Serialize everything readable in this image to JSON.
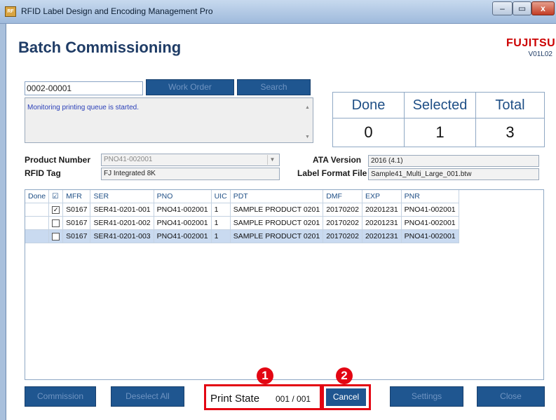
{
  "window": {
    "title": "RFID Label Design and Encoding Management Pro",
    "app_icon": "rfid-app-icon",
    "min_glyph": "–",
    "max_glyph": "▭",
    "close_glyph": "x"
  },
  "header": {
    "title": "Batch Commissioning",
    "logo": "FUJITSU",
    "version": "V01L02"
  },
  "order": {
    "value": "0002-00001",
    "work_order_label": "Work Order",
    "search_label": "Search"
  },
  "message": {
    "text": "Monitoring printing queue is started."
  },
  "counters": {
    "done_label": "Done",
    "done_value": "0",
    "selected_label": "Selected",
    "selected_value": "1",
    "total_label": "Total",
    "total_value": "3"
  },
  "product": {
    "product_number_label": "Product Number",
    "product_number_value": "PNO41-002001",
    "rfid_tag_label": "RFID Tag",
    "rfid_tag_value": "FJ Integrated 8K",
    "ata_version_label": "ATA Version",
    "ata_version_value": "2016 (4.1)",
    "label_format_label": "Label Format File",
    "label_format_value": "Sample41_Multi_Large_001.btw"
  },
  "table": {
    "headers": [
      "Done",
      "☑",
      "MFR",
      "SER",
      "PNO",
      "UIC",
      "PDT",
      "DMF",
      "EXP",
      "PNR"
    ],
    "rows": [
      {
        "done": "",
        "check": "✓",
        "mfr": "S0167",
        "ser": "SER41-0201-001",
        "pno": "PNO41-002001",
        "uic": "1",
        "pdt": "SAMPLE PRODUCT 0201",
        "dmf": "20170202",
        "exp": "20201231",
        "pnr": "PNO41-002001"
      },
      {
        "done": "",
        "check": "",
        "mfr": "S0167",
        "ser": "SER41-0201-002",
        "pno": "PNO41-002001",
        "uic": "1",
        "pdt": "SAMPLE PRODUCT 0201",
        "dmf": "20170202",
        "exp": "20201231",
        "pnr": "PNO41-002001"
      },
      {
        "done": "",
        "check": "",
        "mfr": "S0167",
        "ser": "SER41-0201-003",
        "pno": "PNO41-002001",
        "uic": "1",
        "pdt": "SAMPLE PRODUCT 0201",
        "dmf": "20170202",
        "exp": "20201231",
        "pnr": "PNO41-002001"
      }
    ]
  },
  "bottom": {
    "commission_label": "Commission",
    "deselect_label": "Deselect All",
    "print_state_label": "Print State",
    "print_state_value": "001  /  001",
    "cancel_label": "Cancel",
    "settings_label": "Settings",
    "close_label": "Close"
  },
  "annotations": {
    "marker_1": "1",
    "marker_2": "2",
    "color": "#e30613"
  }
}
